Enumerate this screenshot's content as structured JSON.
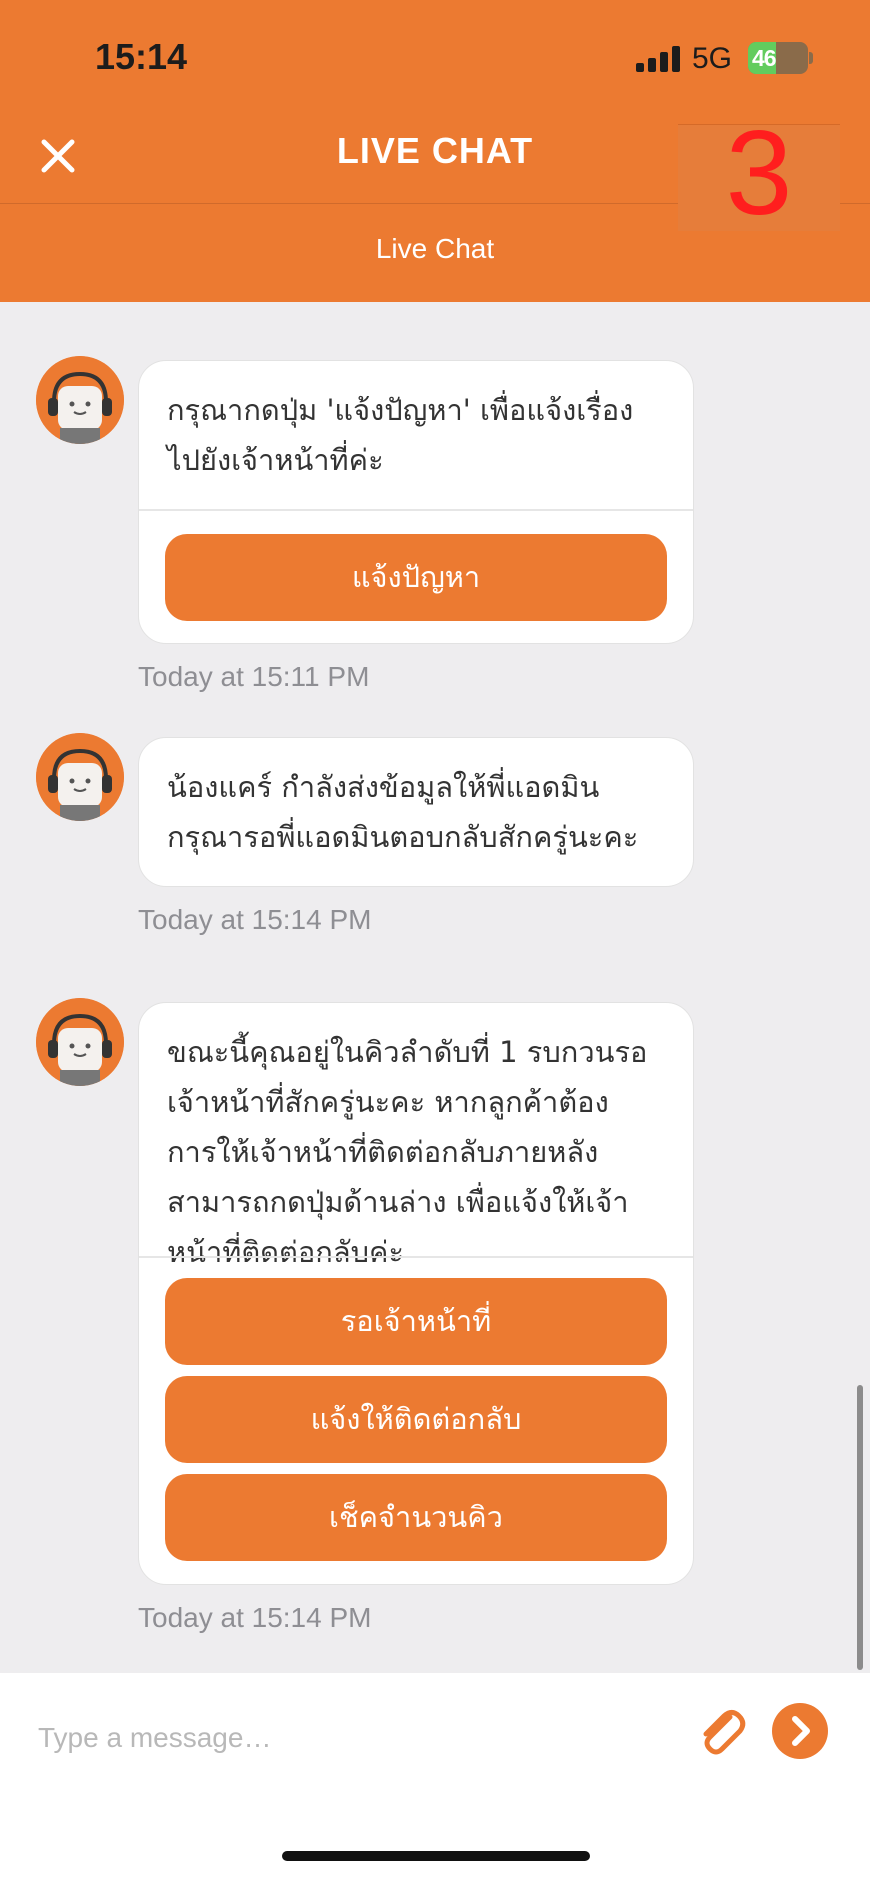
{
  "status_bar": {
    "time": "15:14",
    "network": "5G",
    "battery": "46"
  },
  "header": {
    "title": "LIVE CHAT",
    "subtitle": "Live Chat",
    "overlay_number": "3"
  },
  "messages": [
    {
      "text": "กรุณากดปุ่ม 'แจ้งปัญหา' เพื่อแจ้งเรื่องไปยังเจ้าหน้าที่ค่ะ",
      "buttons": [
        "แจ้งปัญหา"
      ],
      "timestamp": "Today at 15:11 PM"
    },
    {
      "text": "น้องแคร์ กำลังส่งข้อมูลให้พี่แอดมิน กรุณารอพี่แอดมินตอบกลับสักครู่นะคะ",
      "buttons": [],
      "timestamp": "Today at 15:14 PM"
    },
    {
      "text": "ขณะนี้คุณอยู่ในคิวลำดับที่ 1 รบกวนรอเจ้าหน้าที่สักครู่นะคะ หากลูกค้าต้อง การให้เจ้าหน้าที่ติดต่อกลับภายหลัง สามารถกดปุ่มด้านล่าง เพื่อแจ้งให้เจ้าหน้าที่ติดต่อกลับค่ะ",
      "buttons": [
        "รอเจ้าหน้าที่",
        "แจ้งให้ติดต่อกลับ",
        "เช็คจำนวนคิว"
      ],
      "timestamp": "Today at 15:14 PM"
    }
  ],
  "composer": {
    "placeholder": "Type a message…"
  },
  "colors": {
    "brand": "#ec7a31",
    "background": "#eeedef",
    "overlay_number": "#ff1e1e"
  },
  "icons": [
    "close-icon",
    "attach-icon",
    "send-icon",
    "bot-avatar-icon"
  ]
}
